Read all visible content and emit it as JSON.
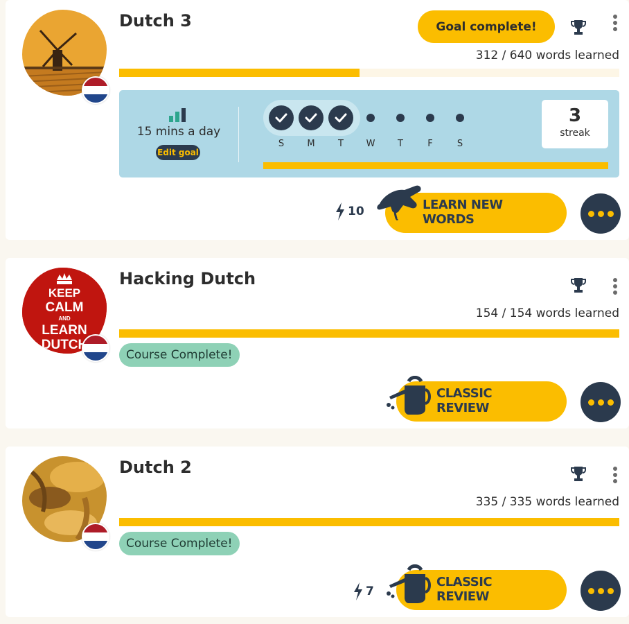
{
  "courses": [
    {
      "title": "Dutch 3",
      "goal_badge": "Goal complete!",
      "words_learned": "312 / 640 words learned",
      "progress": 0.48,
      "avatar": "windmill-image",
      "flag": "netherlands-flag",
      "goal": {
        "mins_text": "15 mins a day",
        "edit_label": "Edit goal",
        "days": [
          {
            "letter": "S",
            "done": true
          },
          {
            "letter": "M",
            "done": true
          },
          {
            "letter": "T",
            "done": true
          },
          {
            "letter": "W",
            "done": false
          },
          {
            "letter": "T",
            "done": false
          },
          {
            "letter": "F",
            "done": false
          },
          {
            "letter": "S",
            "done": false
          }
        ],
        "streak_value": "3",
        "streak_label": "streak"
      },
      "points": "10",
      "action_label": "LEARN NEW\nWORDS",
      "action_icon": "planting-hand-icon"
    },
    {
      "title": "Hacking Dutch",
      "words_learned": "154 / 154 words learned",
      "progress": 1.0,
      "avatar": "keep-calm-image",
      "avatar_text": [
        "KEEP",
        "CALM",
        "AND",
        "LEARN",
        "DUTCH"
      ],
      "flag": "netherlands-flag",
      "status_pill": "Course Complete!",
      "action_label": "CLASSIC\nREVIEW",
      "action_icon": "watering-can-icon"
    },
    {
      "title": "Dutch 2",
      "words_learned": "335 / 335 words learned",
      "progress": 1.0,
      "avatar": "clogs-image",
      "flag": "netherlands-flag",
      "status_pill": "Course Complete!",
      "points": "7",
      "action_label": "CLASSIC\nREVIEW",
      "action_icon": "watering-can-icon"
    }
  ],
  "colors": {
    "accent": "#fbbd00",
    "dark": "#2b3a4d",
    "goal_panel": "#aed8e6",
    "complete_pill": "#8ed1b6",
    "background": "#faf7f0"
  }
}
